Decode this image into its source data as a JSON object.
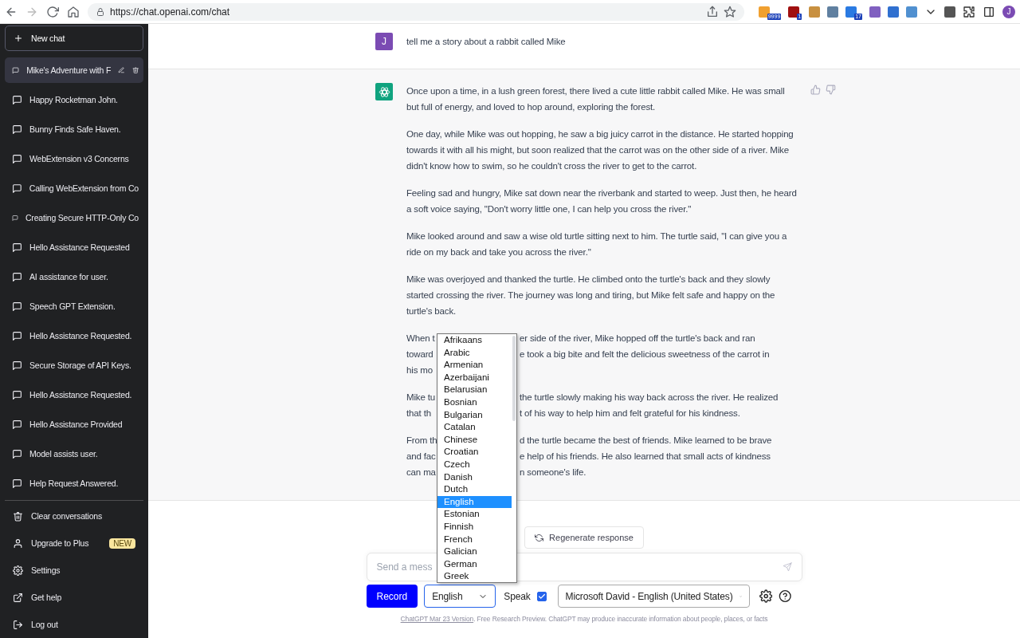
{
  "browser": {
    "url": "https://chat.openai.com/chat",
    "extension_badges": [
      "9999",
      "1",
      "17"
    ],
    "profile_initial": "J"
  },
  "sidebar": {
    "new_chat": "New chat",
    "items": [
      {
        "label": "Mike's Adventure with F",
        "selected": true
      },
      {
        "label": "Happy Rocketman John.",
        "selected": false
      },
      {
        "label": "Bunny Finds Safe Haven.",
        "selected": false
      },
      {
        "label": "WebExtension v3 Concerns",
        "selected": false
      },
      {
        "label": "Calling WebExtension from Co",
        "selected": false
      },
      {
        "label": "Creating Secure HTTP-Only Co",
        "selected": false
      },
      {
        "label": "Hello Assistance Requested",
        "selected": false
      },
      {
        "label": "AI assistance for user.",
        "selected": false
      },
      {
        "label": "Speech GPT Extension.",
        "selected": false
      },
      {
        "label": "Hello Assistance Requested.",
        "selected": false
      },
      {
        "label": "Secure Storage of API Keys.",
        "selected": false
      },
      {
        "label": "Hello Assistance Requested.",
        "selected": false
      },
      {
        "label": "Hello Assistance Provided",
        "selected": false
      },
      {
        "label": "Model assists user.",
        "selected": false
      },
      {
        "label": "Help Request Answered.",
        "selected": false
      }
    ],
    "actions": [
      {
        "label": "Clear conversations",
        "kind": "trash"
      },
      {
        "label": "Upgrade to Plus",
        "kind": "user",
        "badge": "NEW"
      },
      {
        "label": "Settings",
        "kind": "gear"
      },
      {
        "label": "Get help",
        "kind": "external"
      },
      {
        "label": "Log out",
        "kind": "logout"
      }
    ]
  },
  "thread": {
    "user": {
      "initial": "J",
      "text": "tell me a story about a rabbit called Mike"
    },
    "assistant": {
      "paragraphs": [
        {
          "kind": "text",
          "text": "Once upon a time, in a lush green forest, there lived a cute little rabbit called Mike. He was small but full of energy, and loved to hop around, exploring the forest."
        },
        {
          "kind": "text",
          "text": "One day, while Mike was out hopping, he saw a big juicy carrot in the distance. He started hopping towards it with all his might, but soon realized that the carrot was on the other side of a river. Mike didn't know how to swim, so he couldn't cross the river to get to the carrot."
        },
        {
          "kind": "text",
          "text": "Feeling sad and hungry, Mike sat down near the riverbank and started to weep. Just then, he heard a soft voice saying, \"Don't worry little one, I can help you cross the river.\""
        },
        {
          "kind": "text",
          "text": "Mike looked around and saw a wise old turtle sitting next to him. The turtle said, \"I can give you a ride on my back and take you across the river.\""
        },
        {
          "kind": "text",
          "text": "Mike was overjoyed and thanked the turtle. He climbed onto the turtle's back and they slowly started crossing the river. The journey was long and tiring, but Mike felt safe and happy on the turtle's back."
        },
        {
          "kind": "covered",
          "lines": [
            [
              "When t",
              "er side of the river, Mike hopped off the turtle's back and ran"
            ],
            [
              "toward",
              "e took a big bite and felt the delicious sweetness of the carrot in"
            ],
            [
              "his mo"
            ]
          ]
        },
        {
          "kind": "covered",
          "lines": [
            [
              "Mike tu",
              "the turtle slowly making his way back across the river. He realized"
            ],
            [
              "that th",
              "t of his way to help him and felt grateful for his kindness."
            ]
          ]
        },
        {
          "kind": "covered",
          "lines": [
            [
              "From th",
              "d the turtle became the best of friends. Mike learned to be brave"
            ],
            [
              "and fac",
              "e help of his friends. He also learned that small acts of kindness"
            ],
            [
              "can ma",
              "n someone's life."
            ]
          ]
        }
      ]
    }
  },
  "composer": {
    "regenerate": "Regenerate response",
    "placeholder": "Send a mess",
    "record": "Record",
    "language": "English",
    "speak": {
      "label": "Speak",
      "checked": true
    },
    "voice": "Microsoft David - English (United States)",
    "footer": {
      "link": "ChatGPT Mar 23 Version",
      "text": ". Free Research Preview. ChatGPT may produce inaccurate information about people, places, or facts"
    }
  },
  "language_list": {
    "options": [
      {
        "label": "Afrikaans",
        "selected": false
      },
      {
        "label": "Arabic",
        "selected": false
      },
      {
        "label": "Armenian",
        "selected": false
      },
      {
        "label": "Azerbaijani",
        "selected": false
      },
      {
        "label": "Belarusian",
        "selected": false
      },
      {
        "label": "Bosnian",
        "selected": false
      },
      {
        "label": "Bulgarian",
        "selected": false
      },
      {
        "label": "Catalan",
        "selected": false
      },
      {
        "label": "Chinese",
        "selected": false
      },
      {
        "label": "Croatian",
        "selected": false
      },
      {
        "label": "Czech",
        "selected": false
      },
      {
        "label": "Danish",
        "selected": false
      },
      {
        "label": "Dutch",
        "selected": false
      },
      {
        "label": "English",
        "selected": true
      },
      {
        "label": "Estonian",
        "selected": false
      },
      {
        "label": "Finnish",
        "selected": false
      },
      {
        "label": "French",
        "selected": false
      },
      {
        "label": "Galician",
        "selected": false
      },
      {
        "label": "German",
        "selected": false
      },
      {
        "label": "Greek",
        "selected": false
      }
    ]
  }
}
